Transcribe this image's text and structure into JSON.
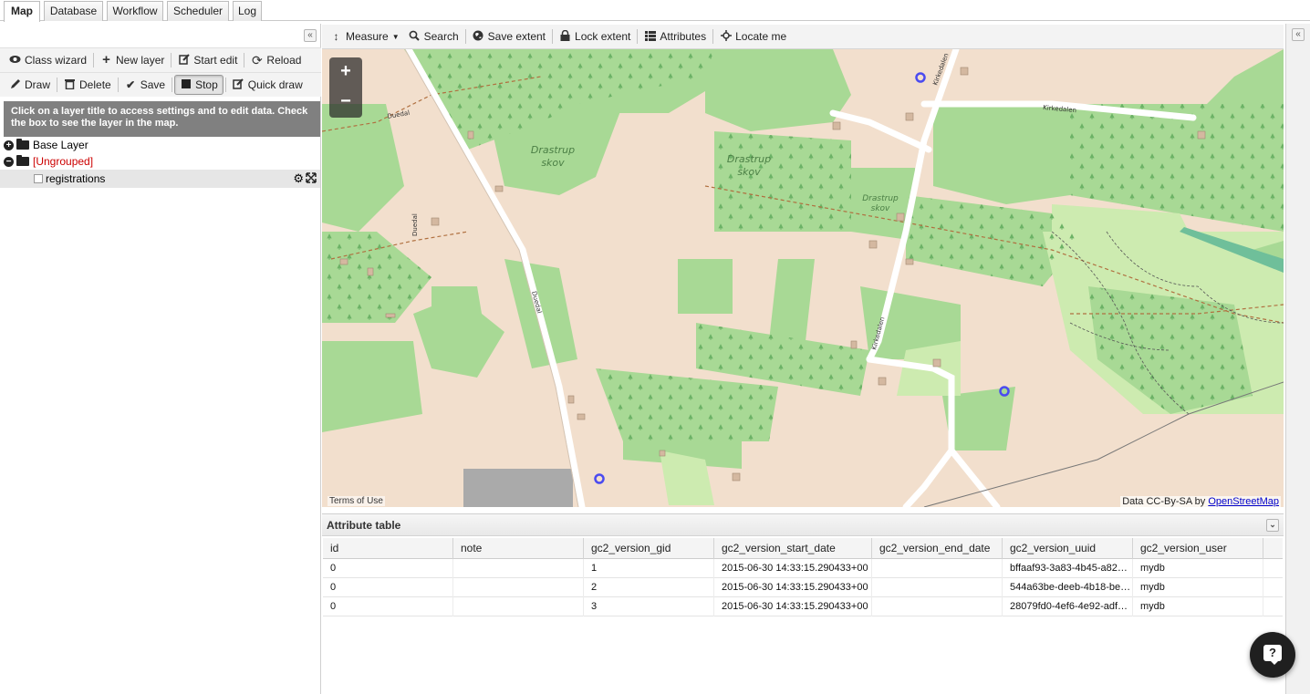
{
  "tabs": [
    {
      "label": "Map",
      "active": true
    },
    {
      "label": "Database",
      "active": false
    },
    {
      "label": "Workflow",
      "active": false
    },
    {
      "label": "Scheduler",
      "active": false
    },
    {
      "label": "Log",
      "active": false
    }
  ],
  "left_panel": {
    "collapse_icon": "«",
    "row1": {
      "class_wizard": "Class wizard",
      "new_layer": "New layer",
      "start_edit": "Start edit",
      "reload": "Reload"
    },
    "row2": {
      "draw": "Draw",
      "delete": "Delete",
      "save": "Save",
      "stop": "Stop",
      "quick_draw": "Quick draw"
    },
    "info": "Click on a layer title to access settings and to edit data. Check the box to see the layer in the map.",
    "tree": {
      "base_layer": "Base Layer",
      "ungrouped": "[Ungrouped]",
      "registrations": "registrations"
    }
  },
  "map_toolbar": {
    "measure": "Measure",
    "search": "Search",
    "save_extent": "Save extent",
    "lock_extent": "Lock extent",
    "attributes": "Attributes",
    "locate_me": "Locate me"
  },
  "map": {
    "zoom_in": "+",
    "zoom_out": "−",
    "terms": "Terms of Use",
    "attribution_prefix": "Data CC-By-SA by",
    "attribution_link": "OpenStreetMap",
    "labels": {
      "drastrup1a": "Drastrup",
      "drastrup1b": "skov",
      "drastrup2a": "Drastrup",
      "drastrup2b": "skov",
      "drastrup3a": "Drastrup",
      "drastrup3b": "skov",
      "duedal1": "Duedal",
      "duedal2": "Duedal",
      "duedal3": "Duedal",
      "kirkedalen1": "Kirkedalen",
      "kirkedalen2": "Kirkedalen",
      "kirkedalen3": "Kirkedalen"
    },
    "colors": {
      "land": "#f2dfcd",
      "forest": "#9fd28a",
      "grass": "#cdebb0",
      "road": "#ffffff",
      "marker": "#4b4bf0"
    }
  },
  "attribute_table": {
    "title": "Attribute table",
    "columns": [
      "id",
      "note",
      "gc2_version_gid",
      "gc2_version_start_date",
      "gc2_version_end_date",
      "gc2_version_uuid",
      "gc2_version_user"
    ],
    "rows": [
      [
        "0",
        "",
        "1",
        "2015-06-30 14:33:15.290433+00",
        "",
        "bffaaf93-3a83-4b45-a82…",
        "mydb"
      ],
      [
        "0",
        "",
        "2",
        "2015-06-30 14:33:15.290433+00",
        "",
        "544a63be-deeb-4b18-be…",
        "mydb"
      ],
      [
        "0",
        "",
        "3",
        "2015-06-30 14:33:15.290433+00",
        "",
        "28079fd0-4ef6-4e92-adf…",
        "mydb"
      ]
    ]
  },
  "help": "?"
}
